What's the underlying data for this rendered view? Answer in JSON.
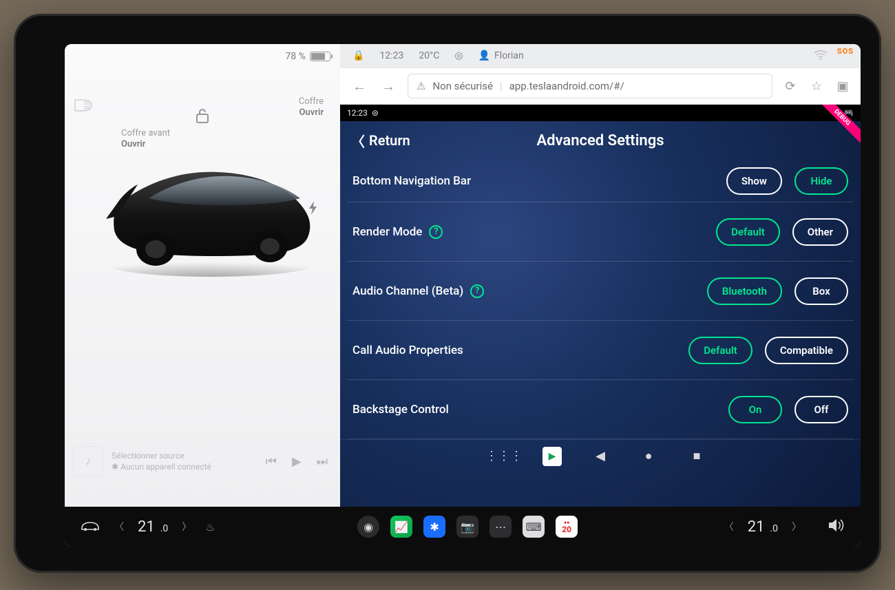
{
  "left": {
    "battery_pct": "78 %",
    "frunk_label": "Coffre avant",
    "frunk_action": "Ouvrir",
    "trunk_label": "Coffre",
    "trunk_action": "Ouvrir",
    "media_title": "Sélectionner source",
    "media_sub": "✱ Aucun appareil connecté"
  },
  "status": {
    "time": "12:23",
    "temp": "20°C",
    "user": "Florian",
    "sos": "SOS"
  },
  "browser": {
    "security": "Non sécurisé",
    "url": "app.teslaandroid.com/#/"
  },
  "android": {
    "time": "12:23",
    "ribbon": "DEBUG"
  },
  "app": {
    "return": "Return",
    "title": "Advanced Settings",
    "rows": [
      {
        "label": "Bottom Navigation Bar",
        "help": false,
        "opts": [
          "Show",
          "Hide"
        ],
        "active": 1
      },
      {
        "label": "Render Mode",
        "help": true,
        "opts": [
          "Default",
          "Other"
        ],
        "active": 0
      },
      {
        "label": "Audio Channel (Beta)",
        "help": true,
        "opts": [
          "Bluetooth",
          "Box"
        ],
        "active": 0
      },
      {
        "label": "Call Audio Properties",
        "help": false,
        "opts": [
          "Default",
          "Compatible"
        ],
        "active": 0
      },
      {
        "label": "Backstage Control",
        "help": false,
        "opts": [
          "On",
          "Off"
        ],
        "active": 0
      }
    ]
  },
  "dock": {
    "left_temp_int": "21",
    "left_temp_frac": ".0",
    "right_temp_int": "21",
    "right_temp_frac": ".0",
    "calendar_day": "20"
  }
}
